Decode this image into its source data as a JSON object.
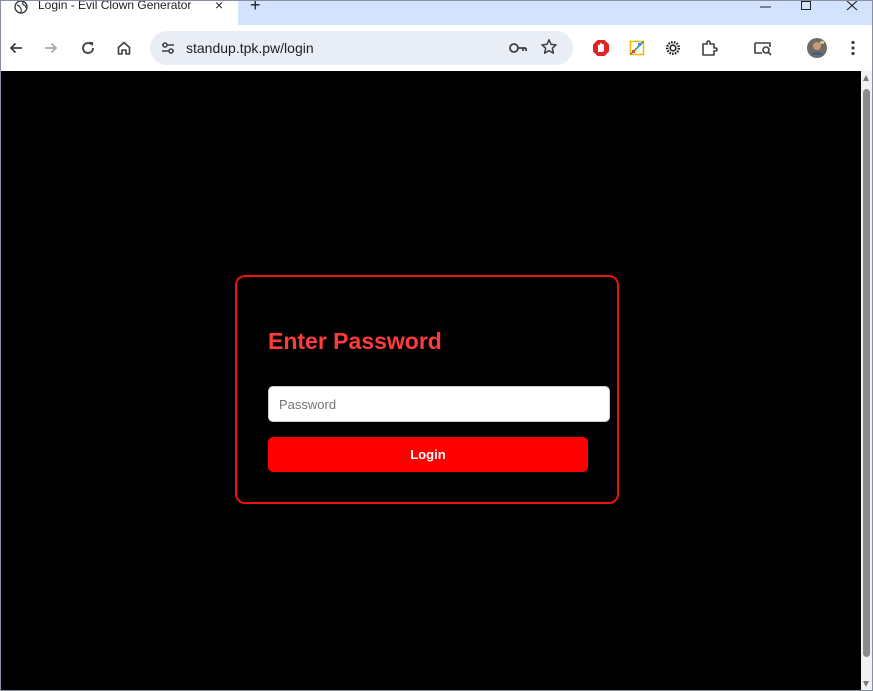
{
  "browser": {
    "tab": {
      "title": "Login - Evil Clown Generator",
      "close_glyph": "×",
      "favicon": "globe-icon"
    },
    "new_tab_glyph": "+",
    "address_bar": {
      "url": "standup.tpk.pw/login"
    },
    "icons": [
      "back-arrow-icon",
      "forward-arrow-icon",
      "reload-icon",
      "home-icon",
      "site-settings-icon",
      "password-key-icon",
      "bookmark-star-icon",
      "adblock-icon",
      "color-picker-extension-icon",
      "sun-extension-icon",
      "extensions-puzzle-icon",
      "tab-search-icon",
      "profile-avatar",
      "menu-kebab-icon"
    ]
  },
  "login": {
    "heading": "Enter Password",
    "password_placeholder": "Password",
    "password_value": "",
    "button_label": "Login"
  },
  "colors": {
    "page_background": "#000000",
    "accent_red": "#ff0000",
    "heading_red": "#ff3b3b",
    "card_border": "#ee1111",
    "tabstrip": "#d3e3fd",
    "omnibox": "#e9eef6"
  }
}
